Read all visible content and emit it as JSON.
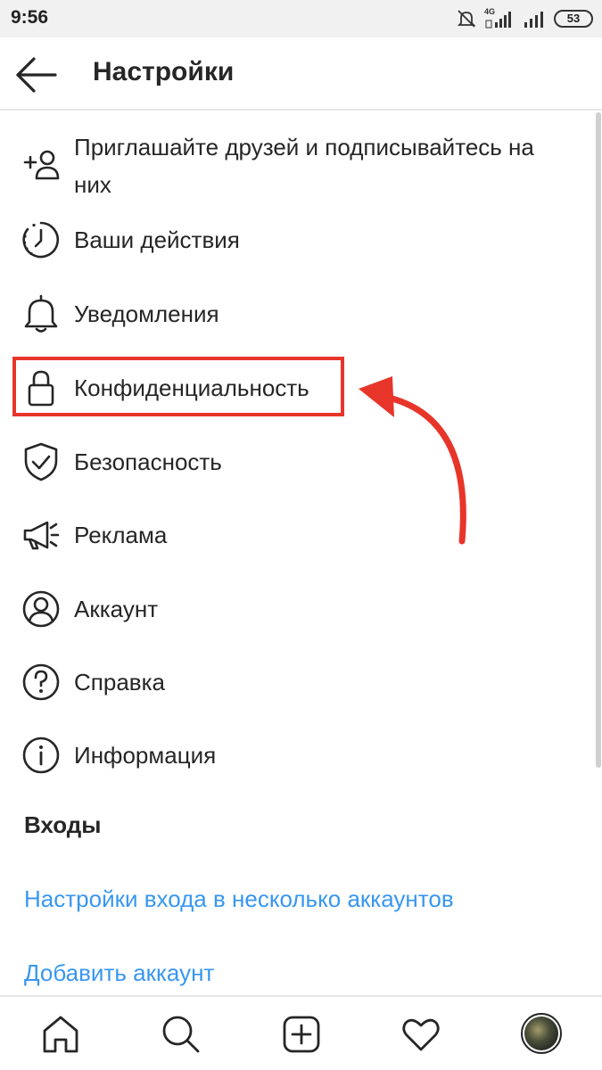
{
  "status_bar": {
    "time": "9:56",
    "network_label": "4G",
    "battery": "53"
  },
  "header": {
    "title": "Настройки"
  },
  "menu": {
    "items": [
      {
        "label": "Приглашайте друзей и подписывайтесь на",
        "label_line2": "них",
        "icon": "add-person-icon"
      },
      {
        "label": "Ваши действия",
        "icon": "activity-clock-icon"
      },
      {
        "label": "Уведомления",
        "icon": "bell-icon"
      },
      {
        "label": "Конфиденциальность",
        "icon": "lock-icon"
      },
      {
        "label": "Безопасность",
        "icon": "shield-check-icon"
      },
      {
        "label": "Реклама",
        "icon": "megaphone-icon"
      },
      {
        "label": "Аккаунт",
        "icon": "account-circle-icon"
      },
      {
        "label": "Справка",
        "icon": "help-circle-icon"
      },
      {
        "label": "Информация",
        "icon": "info-circle-icon"
      }
    ]
  },
  "logins": {
    "section_title": "Входы",
    "multi_account_link": "Настройки входа в несколько аккаунтов",
    "add_account_link": "Добавить аккаунт"
  },
  "colors": {
    "link": "#3897f0",
    "highlight": "#e8352a",
    "text": "#262626"
  },
  "tab_bar": {
    "tabs": [
      "home-icon",
      "search-icon",
      "new-post-icon",
      "heart-icon",
      "profile-avatar"
    ]
  }
}
